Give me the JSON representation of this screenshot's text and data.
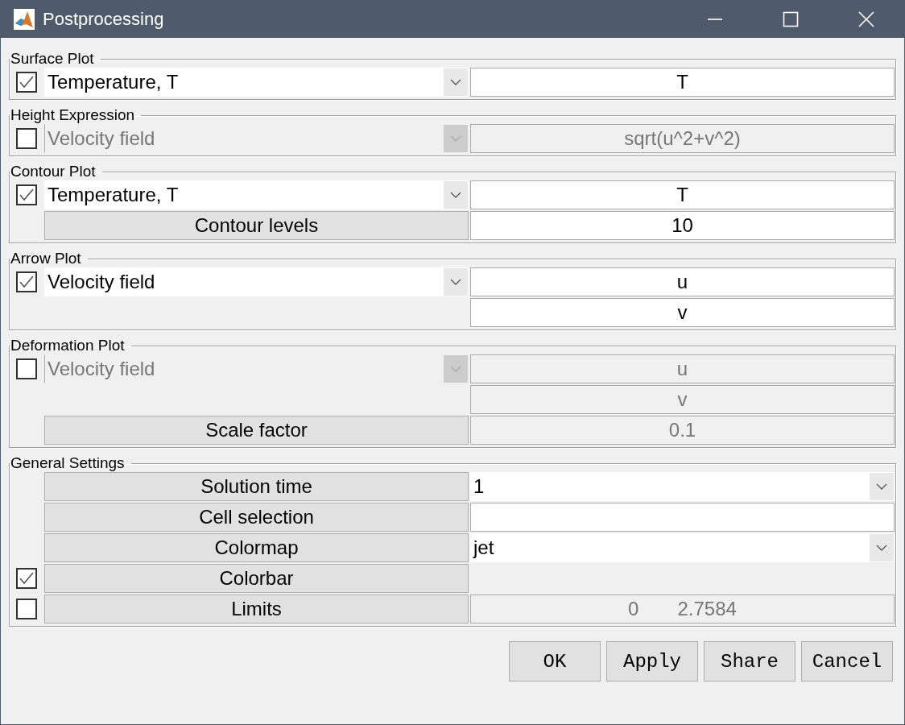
{
  "window": {
    "title": "Postprocessing"
  },
  "groups": [
    {
      "title": "Surface Plot",
      "rows": [
        {
          "checkbox": {
            "checked": true
          },
          "left": {
            "kind": "dropdown",
            "text": "Temperature, T",
            "disabled": false
          },
          "right": {
            "kind": "field",
            "values": [
              "T"
            ],
            "disabled": false
          }
        }
      ]
    },
    {
      "title": "Height Expression",
      "rows": [
        {
          "checkbox": {
            "checked": false
          },
          "left": {
            "kind": "dropdown",
            "text": "Velocity field",
            "disabled": true
          },
          "right": {
            "kind": "field",
            "values": [
              "sqrt(u^2+v^2)"
            ],
            "disabled": true
          }
        }
      ]
    },
    {
      "title": "Contour Plot",
      "rows": [
        {
          "checkbox": {
            "checked": true
          },
          "left": {
            "kind": "dropdown",
            "text": "Temperature, T",
            "disabled": false
          },
          "right": {
            "kind": "field",
            "values": [
              "T"
            ],
            "disabled": false
          }
        },
        {
          "left": {
            "kind": "button",
            "text": "Contour levels"
          },
          "right": {
            "kind": "field",
            "values": [
              "10"
            ],
            "disabled": false
          }
        }
      ]
    },
    {
      "title": "Arrow Plot",
      "rows": [
        {
          "checkbox": {
            "checked": true
          },
          "left": {
            "kind": "dropdown",
            "text": "Velocity field",
            "disabled": false
          },
          "right": {
            "kind": "field",
            "values": [
              "u"
            ],
            "disabled": false
          }
        },
        {
          "right": {
            "kind": "field",
            "values": [
              "v"
            ],
            "disabled": false
          }
        }
      ]
    },
    {
      "title": "Deformation Plot",
      "rows": [
        {
          "checkbox": {
            "checked": false
          },
          "left": {
            "kind": "dropdown",
            "text": "Velocity field",
            "disabled": true
          },
          "right": {
            "kind": "field",
            "values": [
              "u"
            ],
            "disabled": true
          }
        },
        {
          "right": {
            "kind": "field",
            "values": [
              "v"
            ],
            "disabled": true
          }
        },
        {
          "left": {
            "kind": "button",
            "text": "Scale factor"
          },
          "right": {
            "kind": "field",
            "values": [
              "0.1"
            ],
            "disabled": true
          }
        }
      ]
    },
    {
      "title": "General Settings",
      "rows": [
        {
          "left": {
            "kind": "button",
            "text": "Solution time"
          },
          "right": {
            "kind": "dropdown",
            "text": "1",
            "disabled": false
          }
        },
        {
          "left": {
            "kind": "button",
            "text": "Cell selection"
          },
          "right": {
            "kind": "field",
            "disabled": false
          }
        },
        {
          "left": {
            "kind": "button",
            "text": "Colormap"
          },
          "right": {
            "kind": "dropdown",
            "text": "jet",
            "disabled": false
          }
        },
        {
          "checkbox": {
            "checked": true
          },
          "left": {
            "kind": "button",
            "text": "Colorbar"
          }
        },
        {
          "checkbox": {
            "checked": false
          },
          "left": {
            "kind": "button",
            "text": "Limits"
          },
          "right": {
            "kind": "field",
            "values": [
              "0",
              "2.7584"
            ],
            "disabled": true
          }
        }
      ]
    }
  ],
  "buttons": [
    "OK",
    "Apply",
    "Share",
    "Cancel"
  ]
}
